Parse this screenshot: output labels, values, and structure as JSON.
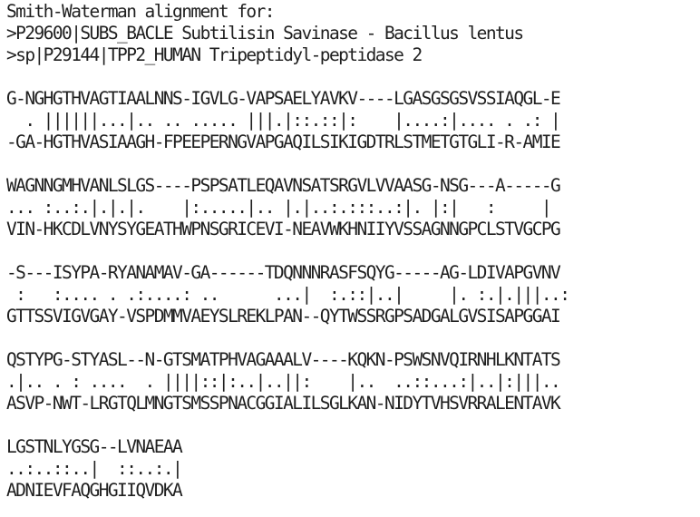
{
  "header": {
    "title": "Smith-Waterman alignment for:",
    "seq1_desc": ">P29600|SUBS_BACLE Subtilisin Savinase - Bacillus lentus",
    "seq2_desc": ">sp|P29144|TPP2_HUMAN Tripeptidyl-peptidase 2"
  },
  "alignment": {
    "blocks": [
      {
        "top": "G-NGHGTHVAGTIAALNNS-IGVLG-VAPSAELYAVKV----LGASGSGSVSSIAQGL-E",
        "match": "  . ||||||...|.. .. ..... |||.|::.::|:    |....:|.... . .: |",
        "bottom": "-GA-HGTHVASIAAGH-FPEEPERNGVAPGAQILSIKIGDTRLSTMETGTGLI-R-AMIE"
      },
      {
        "top": "WAGNNGMHVANLSLGS----PSPSATLEQAVNSATSRGVLVVAASG-NSG---A-----G",
        "match": "... :..:.|.|.|.    |:.....|.. |.|..:.:::..:|. |:|   :     |",
        "bottom": "VIN-HKCDLVNYSYGEATHWPNSGRICEVI-NEAVWKHNIIYVSSAGNNGPCLSTVGCPG"
      },
      {
        "top": "-S---ISYPA-RYANAMAV-GA------TDQNNNRASFSQYG-----AG-LDIVAPGVNV",
        "match": " :   :.... . .:....: ..      ...|  :.::|..|     |. :.|.|||..:",
        "bottom": "GTTSSVIGVGAY-VSPDMMVAEYSLREKLPAN--QYTWSSRGPSADGALGVSISAPGGAI"
      },
      {
        "top": "QSTYPG-STYASL--N-GTSMATPHVAGAAALV----KQKN-PSWSNVQIRNHLKNTATS",
        "match": ".|.. . : ....  . ||||::|:..|..||:    |..  ..::...:|..|:|||..",
        "bottom": "ASVP-NWT-LRGTQLMNGTSMSSPNACGGIALILSGLKAN-NIDYTVHSVRRALENTAVK"
      },
      {
        "top": "LGSTNLYGSG--LVNAEAA",
        "match": "..:..::..|  ::..:.|",
        "bottom": "ADNIEVFAQGHGIIQVDKA"
      }
    ]
  }
}
